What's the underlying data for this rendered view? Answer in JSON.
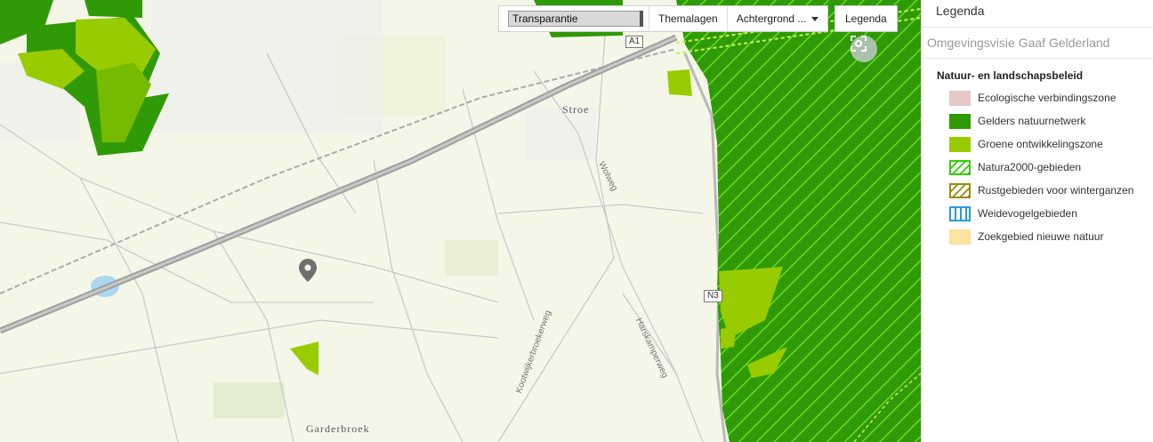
{
  "toolbar": {
    "transparency_label": "Transparantie",
    "themalagen_label": "Themalagen",
    "achtergrond_label": "Achtergrond ...",
    "legenda_label": "Legenda"
  },
  "map": {
    "places": [
      "Stroe",
      "Garderbroek"
    ],
    "roads": {
      "a1": "A1",
      "n3": "N3",
      "wolweg": "Wolweg",
      "kootwijkerbroekerweg": "Kootwijkerbroekerweg",
      "harskamperweg": "Harskamperweg"
    },
    "icons": {
      "locate": "locate-icon",
      "marker": "map-marker-icon"
    }
  },
  "panel": {
    "title": "Legenda",
    "subtitle": "Omgevingsvisie Gaaf Gelderland",
    "group_title": "Natuur- en landschapsbeleid",
    "items": [
      {
        "label": "Ecologische verbindingszone",
        "color": "#e6c8c8",
        "style": "fill"
      },
      {
        "label": "Gelders natuurnetwerk",
        "color": "#2f9a05",
        "style": "fill"
      },
      {
        "label": "Groene ontwikkelingszone",
        "color": "#99cc00",
        "style": "fill"
      },
      {
        "label": "Natura2000-gebieden",
        "color": "#33cc00",
        "style": "hatch"
      },
      {
        "label": "Rustgebieden voor winterganzen",
        "color": "#9a8a10",
        "style": "hatch"
      },
      {
        "label": "Weidevogelgebieden",
        "color": "#2a9bd8",
        "style": "vertical"
      },
      {
        "label": "Zoekgebied nieuwe natuur",
        "color": "#fde3a0",
        "style": "fill"
      }
    ]
  }
}
